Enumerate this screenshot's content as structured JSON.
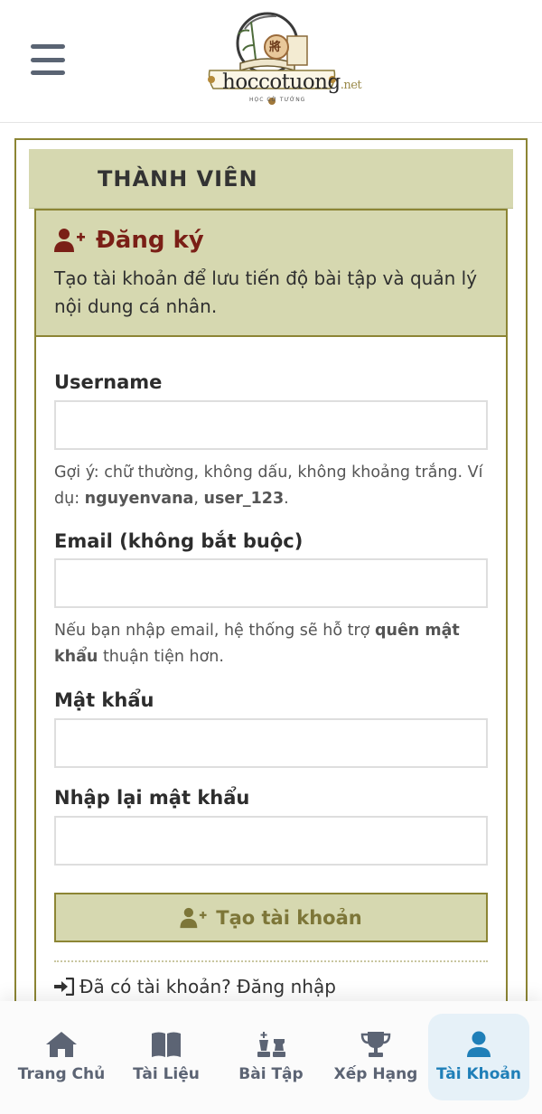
{
  "header": {
    "logo": {
      "brand": "hoccotuong",
      "tld": ".net",
      "tagline": "HỌC CỜ TƯỚNG",
      "piece_glyph": "將"
    }
  },
  "section": {
    "title": "THÀNH VIÊN"
  },
  "register": {
    "title": "Đăng ký",
    "description": "Tạo tài khoản để lưu tiến độ bài tập và quản lý nội dung cá nhân."
  },
  "form": {
    "username": {
      "label": "Username",
      "value": "",
      "hint_prefix": "Gợi ý: chữ thường, không dấu, không khoảng trắng. Ví dụ: ",
      "example1": "nguyenvana",
      "hint_sep": ", ",
      "example2": "user_123",
      "hint_end": "."
    },
    "email": {
      "label": "Email (không bắt buộc)",
      "value": "",
      "hint_prefix": "Nếu bạn nhập email, hệ thống sẽ hỗ trợ ",
      "hint_bold": "quên mật khẩu",
      "hint_end": " thuận tiện hơn."
    },
    "password": {
      "label": "Mật khẩu",
      "value": ""
    },
    "password_confirm": {
      "label": "Nhập lại mật khẩu",
      "value": ""
    },
    "submit_label": "Tạo tài khoản",
    "login_link": "Đã có tài khoản? Đăng nhập"
  },
  "nav": {
    "items": [
      {
        "label": "Trang Chủ",
        "icon": "home-icon"
      },
      {
        "label": "Tài Liệu",
        "icon": "book-icon"
      },
      {
        "label": "Bài Tập",
        "icon": "chess-icon"
      },
      {
        "label": "Xếp Hạng",
        "icon": "trophy-icon"
      },
      {
        "label": "Tài Khoản",
        "icon": "user-icon",
        "active": true
      }
    ]
  },
  "colors": {
    "accent_olive": "#8c8534",
    "band_bg": "#d6d8b0",
    "title_red": "#7a1f16",
    "nav_active": "#1f7fb8",
    "nav_inactive": "#5c6474"
  }
}
